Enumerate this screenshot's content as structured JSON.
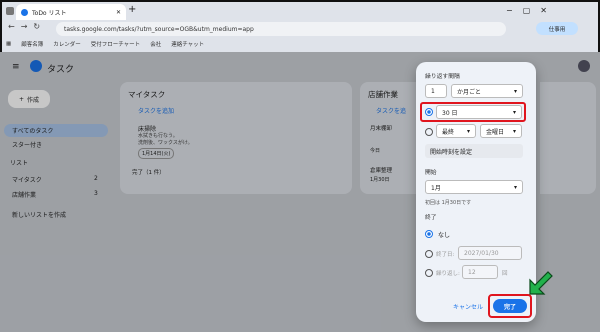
{
  "browser": {
    "tab_title": "ToDo リスト",
    "url": "tasks.google.com/tasks/?utm_source=OGB&utm_medium=app",
    "profile": "仕事用",
    "bookmarks": [
      "顧客名簿",
      "カレンダー",
      "受付フローチャート",
      "会社",
      "連絡チャット"
    ]
  },
  "app": {
    "title": "タスク",
    "create": "作成",
    "all_tasks": "すべてのタスク",
    "starred": "スター付き",
    "lists_header": "リスト",
    "lists": [
      {
        "name": "マイタスク",
        "count": "2"
      },
      {
        "name": "店舗作業",
        "count": "3"
      }
    ],
    "new_list": "新しいリストを作成",
    "col1": {
      "title": "マイタスク",
      "add": "タスクを追加",
      "task_title": "床掃除",
      "task_desc": "水拭きも行なう。\n洗剤後、ワックスがけ。",
      "task_date": "1月14日(火)",
      "done": "完了（1 件）"
    },
    "col2": {
      "title": "店舗作業",
      "add": "タスクを追",
      "t1": "月末棚卸",
      "t1_sub": "詳細",
      "t1_date": "今日",
      "t2": "倉庫整理",
      "t2_date": "1月30日"
    }
  },
  "dialog": {
    "repeat_label": "繰り返す間隔",
    "interval": "1",
    "unit": "か月ごと",
    "day_option": "30 日",
    "week_option": "最終",
    "weekday": "金曜日",
    "set_time": "開始時刻を設定",
    "start_label": "開始",
    "start_month": "1月",
    "first_due": "初回は 1月30日です",
    "end_label": "終了",
    "end_never": "なし",
    "end_date_label": "終了日:",
    "end_date_value": "2027/01/30",
    "end_after_label": "繰り返し:",
    "end_after_value": "12",
    "end_after_unit": "回",
    "cancel": "キャンセル",
    "done": "完了"
  },
  "colors": {
    "accent": "#1a73e8",
    "highlight": "#e0151e",
    "arrow": "#22b14c"
  }
}
